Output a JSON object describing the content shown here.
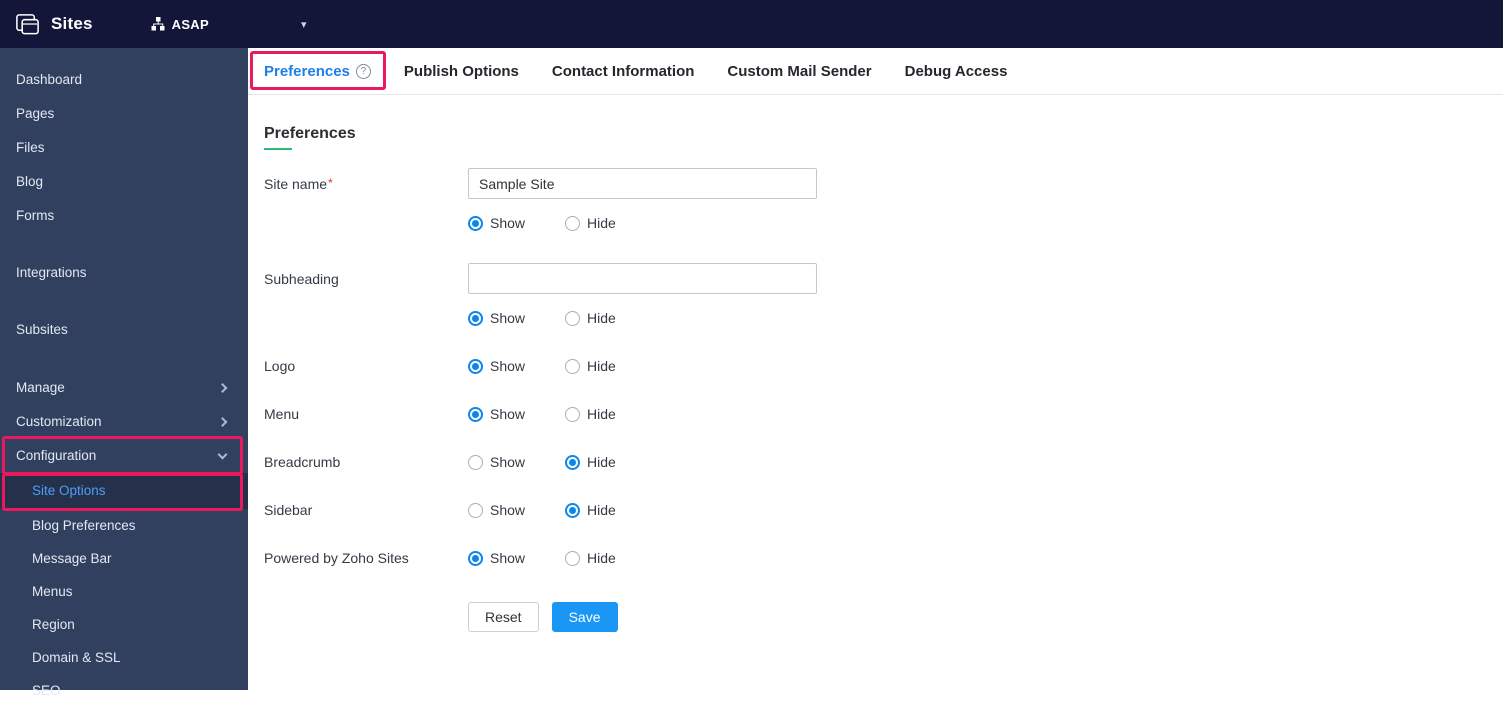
{
  "topbar": {
    "app_name": "Sites",
    "site_name": "ASAP",
    "caret_icon": "▾"
  },
  "icons": {
    "help": "?"
  },
  "sidebar": {
    "items": [
      {
        "label": "Dashboard"
      },
      {
        "label": "Pages"
      },
      {
        "label": "Files"
      },
      {
        "label": "Blog"
      },
      {
        "label": "Forms"
      },
      {
        "label": "Integrations"
      },
      {
        "label": "Subsites"
      }
    ],
    "groups": [
      {
        "label": "Manage",
        "state": "collapsed"
      },
      {
        "label": "Customization",
        "state": "collapsed"
      },
      {
        "label": "Configuration",
        "state": "expanded"
      }
    ],
    "configuration_children": [
      {
        "label": "Site Options",
        "active": true
      },
      {
        "label": "Blog Preferences"
      },
      {
        "label": "Message Bar"
      },
      {
        "label": "Menus"
      },
      {
        "label": "Region"
      },
      {
        "label": "Domain & SSL"
      },
      {
        "label": "SEO"
      }
    ]
  },
  "tabs": [
    {
      "label": "Preferences",
      "active": true
    },
    {
      "label": "Publish Options"
    },
    {
      "label": "Contact Information"
    },
    {
      "label": "Custom Mail Sender"
    },
    {
      "label": "Debug Access"
    }
  ],
  "form": {
    "heading": "Preferences",
    "radio_options": {
      "show": "Show",
      "hide": "Hide"
    },
    "rows": {
      "site_name": {
        "label": "Site name",
        "required": "*",
        "value": "Sample Site",
        "selected": "Show"
      },
      "subheading": {
        "label": "Subheading",
        "value": "",
        "selected": "Show"
      },
      "logo": {
        "label": "Logo",
        "selected": "Show"
      },
      "menu": {
        "label": "Menu",
        "selected": "Show"
      },
      "breadcrumb": {
        "label": "Breadcrumb",
        "selected": "Hide"
      },
      "sidebar": {
        "label": "Sidebar",
        "selected": "Hide"
      },
      "powered_by": {
        "label": "Powered by Zoho Sites",
        "selected": "Show"
      }
    },
    "buttons": {
      "reset": "Reset",
      "save": "Save"
    }
  },
  "colors": {
    "topbar_bg": "#141639",
    "sidebar_bg": "#31405f",
    "active_tab_blue": "#1e7fe8",
    "accent_blue": "#1a97f5",
    "radio_blue": "#0b86ee",
    "active_sidebar_link": "#4d9ff8",
    "annotation_red": "#ea185c",
    "heading_underline_green": "#2eb873",
    "required_red": "#e03131"
  }
}
